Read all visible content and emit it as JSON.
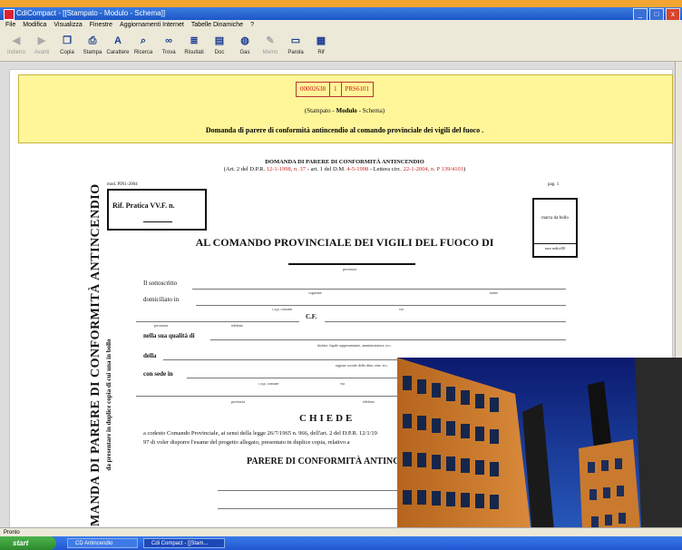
{
  "window": {
    "title": "CdiCompact - [[Stampato - Modulo - Schema]]",
    "buttons": [
      "_",
      "□",
      "x"
    ]
  },
  "menu": [
    "File",
    "Modifica",
    "Visualizza",
    "Finestre",
    "Aggiornamenti Internet",
    "Tabelle Dinamiche",
    "?"
  ],
  "toolbar": [
    {
      "label": "Indietro",
      "icon": "back-icon",
      "disabled": true
    },
    {
      "label": "Avanti",
      "icon": "forward-icon",
      "disabled": true
    },
    {
      "label": "Copia",
      "icon": "copy-icon",
      "disabled": false
    },
    {
      "label": "Stampa",
      "icon": "print-icon",
      "disabled": false
    },
    {
      "label": "Carattere",
      "icon": "font-icon",
      "disabled": false
    },
    {
      "label": "Ricerca",
      "icon": "search-icon",
      "disabled": false
    },
    {
      "label": "Trova",
      "icon": "binoculars-icon",
      "disabled": false
    },
    {
      "label": "Risultati",
      "icon": "results-icon",
      "disabled": false
    },
    {
      "label": "Doc",
      "icon": "document-icon",
      "disabled": false
    },
    {
      "label": "Gas",
      "icon": "gas-icon",
      "disabled": false
    },
    {
      "label": "Memo",
      "icon": "memo-icon",
      "disabled": true
    },
    {
      "label": "Parola",
      "icon": "word-icon",
      "disabled": false
    },
    {
      "label": "Rif",
      "icon": "reference-icon",
      "disabled": false
    }
  ],
  "header": {
    "codes": [
      "00002638",
      "1",
      "PRS6101"
    ],
    "subtitle_parts": [
      "(Stampato - ",
      "Modulo",
      " - Schema)"
    ],
    "title": "Domanda di parere di conformità antincendio al comando provinciale dei vigili del fuoco ."
  },
  "form": {
    "dom_title": "DOMANDA DI PARERE DI CONFORMITÀ ANTINCENDIO",
    "dom_sub_a": "(Art. 2 del D.P.R. ",
    "dom_sub_b": "12-1-1998, n. 37",
    "dom_sub_c": " - art. 1 del D.M. ",
    "dom_sub_d": "4-5-1998",
    "dom_sub_e": " - Lettera circ. ",
    "dom_sub_f": "22-1-2004, n. P 139/4101",
    "dom_sub_g": ")",
    "mod": "mod. PIN1-2004",
    "pag": "pag. 1",
    "rif": "Rif. Pratica VV.F. n.",
    "marca": "marca da bollo",
    "marca_foot": "euro sedici/00",
    "al_comando": "AL COMANDO PROVINCIALE DEI VIGILI DEL FUOCO DI",
    "provincia": "provincia",
    "labels": {
      "sottoscritto": "Il sottoscritto",
      "domiciliato": "domiciliato in",
      "cf": "C.F.",
      "qualita": "nella sua qualità di",
      "della": "della",
      "sede": "con sede in"
    },
    "tiny": {
      "cognome": "cognome",
      "nome": "nome",
      "cap": "c.a.p.   comune",
      "via": "via",
      "provincia2": "provincia",
      "telefono": "telefono",
      "titolare": "titolare, legale rappresentante, amministratore, ecc.",
      "ragione": "ragione sociale della ditta, ente, ecc.",
      "cap2": "c.a.p.   comune",
      "via2": "via",
      "provincia3": "provincia",
      "telefono2": "telefono"
    },
    "vertical_title": "DOMANDA DI PARERE DI CONFORMITÀ ANTINCENDIO",
    "vertical_sub": "da presentare in duplice copia di cui una in bollo",
    "chiede": "CHIEDE",
    "chiede_l1": "a codesto Comando Provinciale, ai sensi della legge 26/7/1965 n. 966, dell'art. 2 del D.P.R. 12/1/19",
    "chiede_l2": "97 di voler disporre l'esame del progetto allegato, presentato in duplice copia, relativo a",
    "parere": "PARERE DI CONFORMITÀ ANTINCENDIO"
  },
  "statusbar": "Pronto",
  "taskbar": {
    "start": "start",
    "tasks": [
      "CD Antincendio",
      "Cdi Compact - [[Stam..."
    ]
  }
}
